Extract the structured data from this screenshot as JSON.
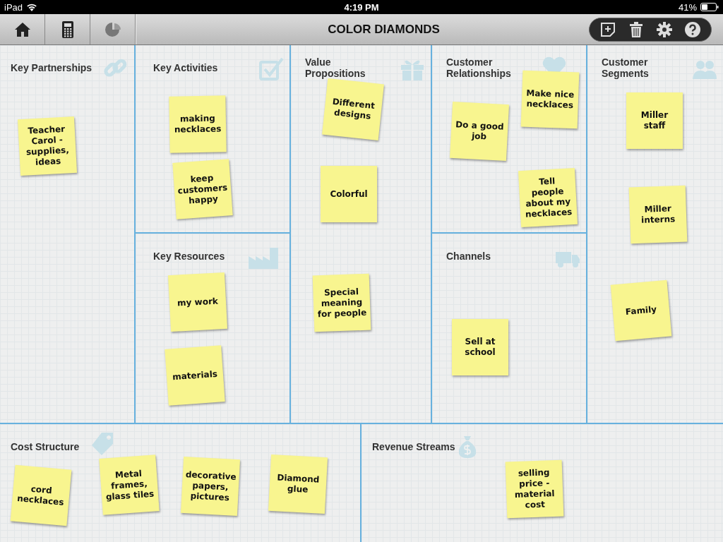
{
  "status_bar": {
    "device": "iPad",
    "time": "4:19 PM",
    "battery": "41%"
  },
  "toolbar": {
    "title": "COLOR DIAMONDS"
  },
  "blocks": [
    {
      "title": "Key Partnerships",
      "notes": [
        {
          "text": "Teacher Carol - supplies, ideas"
        }
      ]
    },
    {
      "title": "Key Activities",
      "notes": [
        {
          "text": "making necklaces"
        },
        {
          "text": "keep customers happy"
        }
      ]
    },
    {
      "title": "Key Resources",
      "notes": [
        {
          "text": "my work"
        },
        {
          "text": "materials"
        }
      ]
    },
    {
      "title": "Value Propositions",
      "notes": [
        {
          "text": "Different designs"
        },
        {
          "text": "Colorful"
        },
        {
          "text": "Special meaning for people"
        }
      ]
    },
    {
      "title": "Customer Relationships",
      "notes": [
        {
          "text": "Make nice necklaces"
        },
        {
          "text": "Do a good job"
        },
        {
          "text": "Tell people about my necklaces"
        }
      ]
    },
    {
      "title": "Channels",
      "notes": [
        {
          "text": "Sell at school"
        }
      ]
    },
    {
      "title": "Customer Segments",
      "notes": [
        {
          "text": "Miller staff"
        },
        {
          "text": "Miller interns"
        },
        {
          "text": "Family"
        }
      ]
    },
    {
      "title": "Cost Structure",
      "notes": [
        {
          "text": "cord necklaces"
        },
        {
          "text": "Metal frames, glass tiles"
        },
        {
          "text": "decorative papers, pictures"
        },
        {
          "text": "Diamond glue"
        }
      ]
    },
    {
      "title": "Revenue Streams",
      "notes": [
        {
          "text": "selling price - material cost"
        }
      ]
    }
  ]
}
